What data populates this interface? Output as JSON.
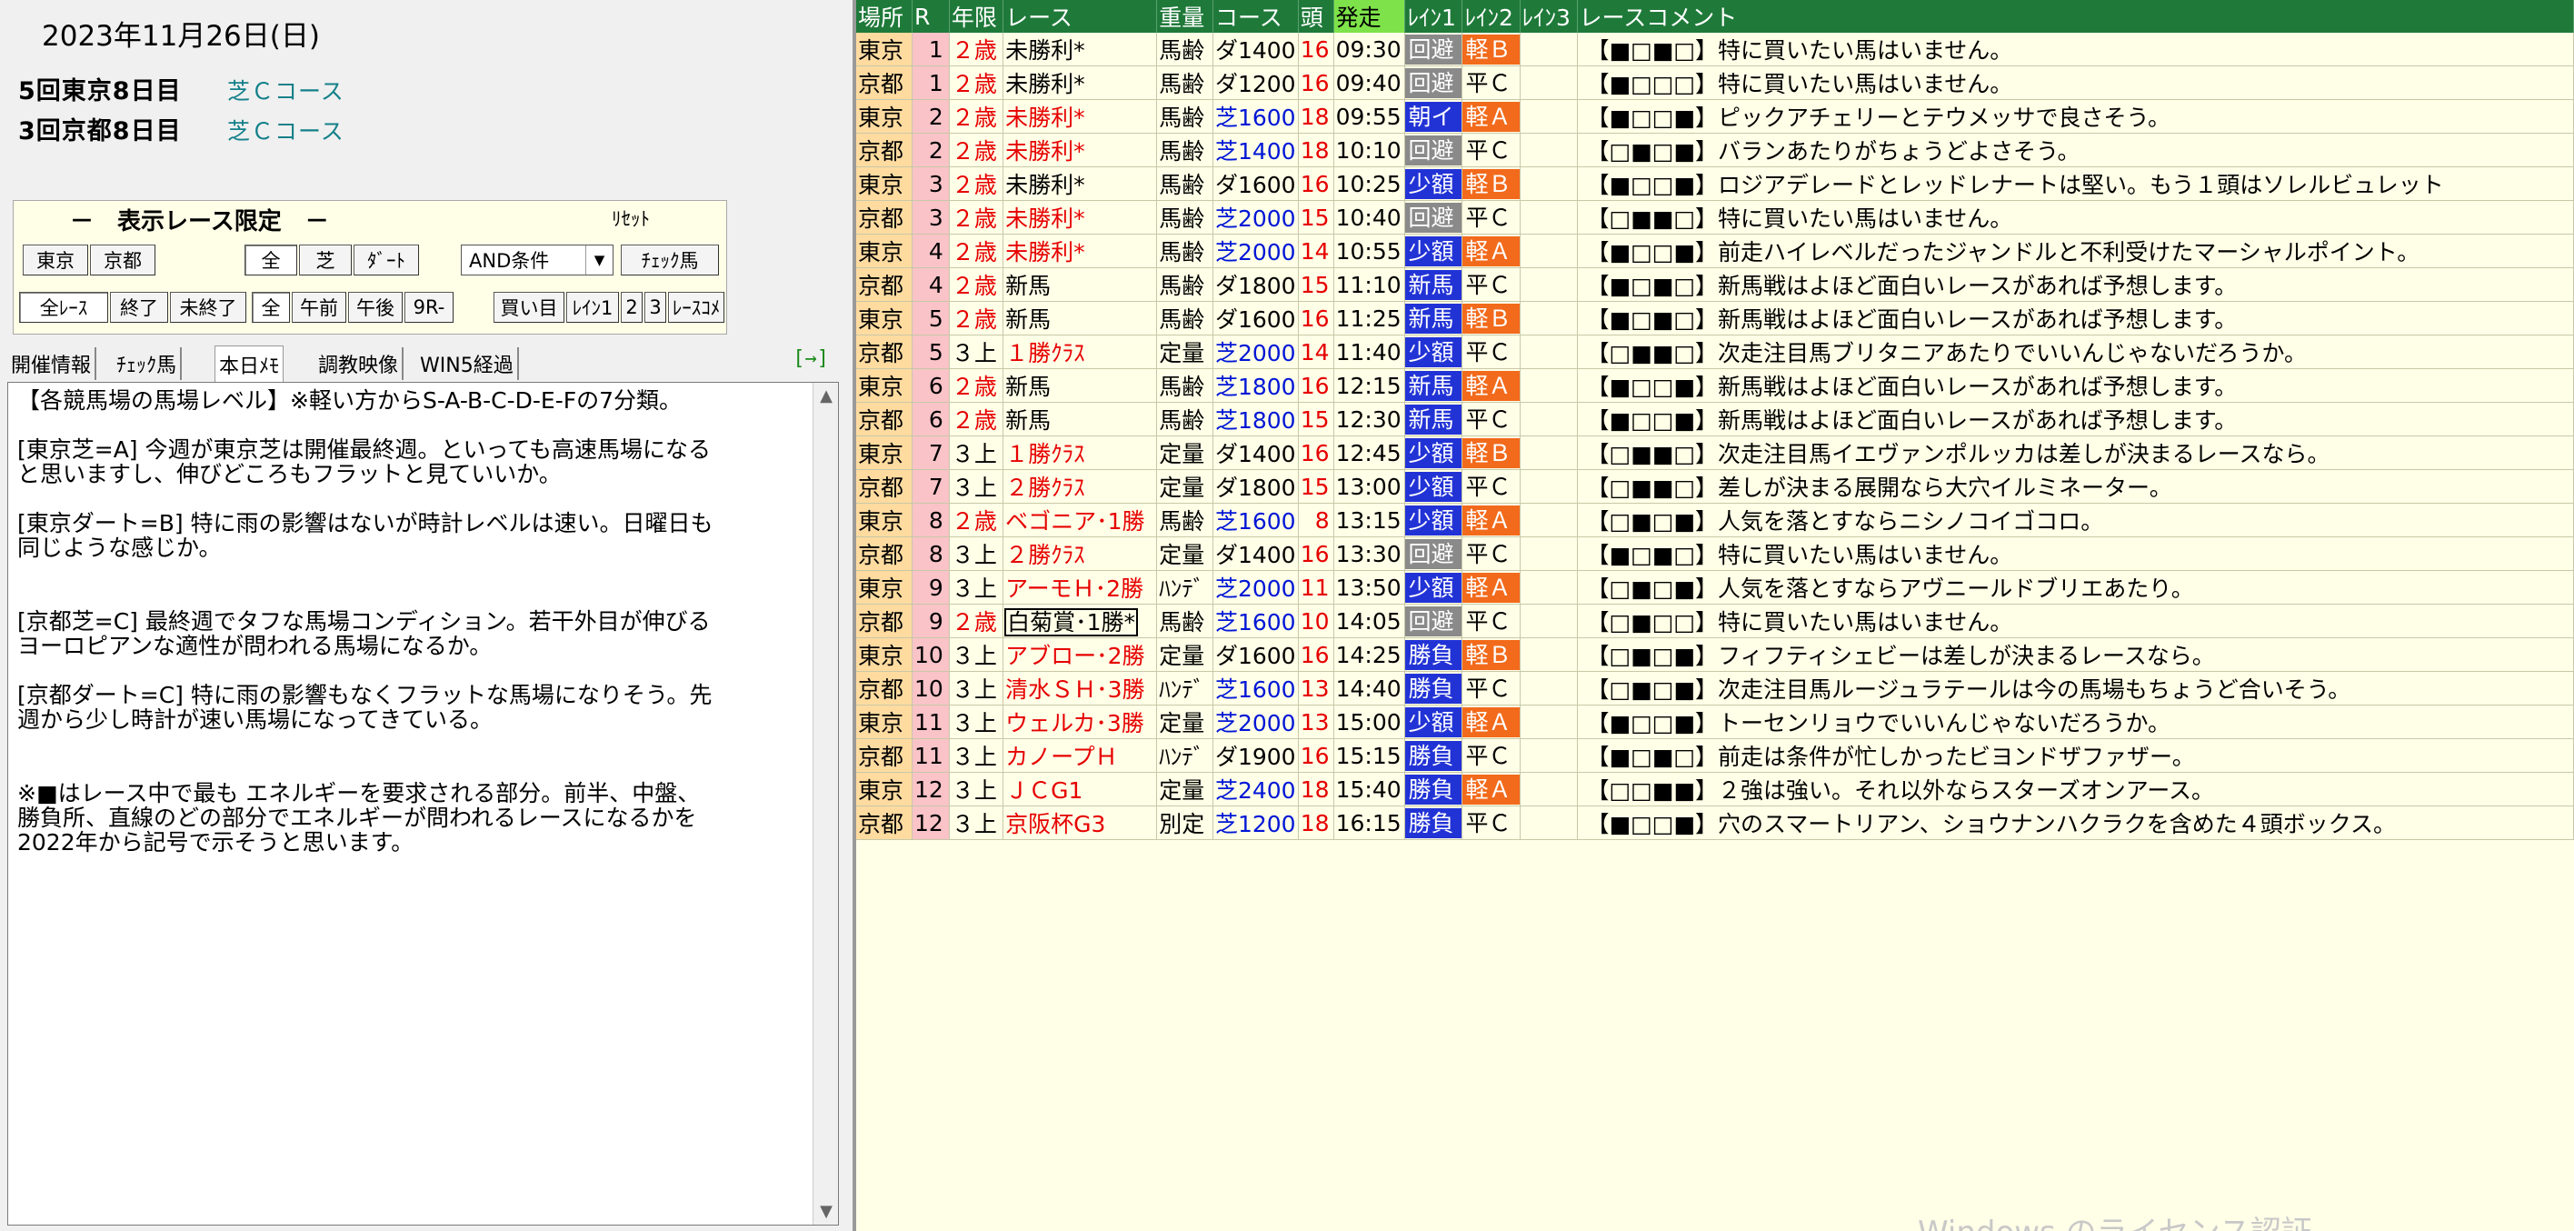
{
  "date": "2023年11月26日(日)",
  "meetings": [
    {
      "name": "5回東京8日目",
      "course": "芝Ｃコース"
    },
    {
      "name": "3回京都8日目",
      "course": "芝Ｃコース"
    }
  ],
  "filter": {
    "title": "－　表示レース限定　－",
    "reset": "ﾘｾｯﾄ",
    "venue_buttons": [
      "東京",
      "京都"
    ],
    "surface_buttons": [
      "全",
      "芝",
      "ﾀﾞｰﾄ"
    ],
    "condition_select": "AND条件",
    "check_button": "ﾁｪｯｸ馬",
    "status_buttons": [
      "全ﾚｰｽ",
      "終了",
      "未終了"
    ],
    "time_buttons": [
      "全",
      "午前",
      "午後",
      "9R-"
    ],
    "mark_buttons": [
      "買い目",
      "ﾚｲﾝ1",
      "2",
      "3",
      "ﾚｰｽｺﾒ"
    ]
  },
  "tabs": [
    "開催情報",
    "ﾁｪｯｸ馬",
    "本日ﾒﾓ",
    "調教映像",
    "WIN5経過"
  ],
  "active_tab": "本日ﾒﾓ",
  "tab_arrow": "[→]",
  "memo": "【各競馬場の馬場レベル】※軽い方からS-A-B-C-D-E-Fの7分類。\n\n[東京芝=A] 今週が東京芝は開催最終週。といっても高速馬場になる\nと思いますし、伸びどころもフラットと見ていいか。\n\n[東京ダート=B] 特に雨の影響はないが時計レベルは速い。日曜日も\n同じような感じか。\n\n\n[京都芝=C] 最終週でタフな馬場コンディション。若干外目が伸びる\nヨーロピアンな適性が問われる馬場になるか。\n\n[京都ダート=C] 特に雨の影響もなくフラットな馬場になりそう。先\n週から少し時計が速い馬場になってきている。\n\n\n※■はレース中で最も エネルギーを要求される部分。前半、中盤、\n勝負所、直線のどの部分でエネルギーが問われるレースになるかを\n2022年から記号で示そうと思います。",
  "table": {
    "headers": [
      "場所",
      "R",
      "年限",
      "レース",
      "重量",
      "コース",
      "頭",
      "発走",
      "ﾚｲﾝ1",
      "ﾚｲﾝ2",
      "ﾚｲﾝ3",
      "レースコメント"
    ],
    "rows": [
      {
        "place": "東京",
        "r": "1",
        "age": "２歳",
        "race": "未勝利*",
        "weight": "馬齢",
        "course": "ダ1400",
        "heads": "16",
        "time": "09:30",
        "l1": "回避",
        "l2": "軽Ｂ",
        "l3": "",
        "comment": "【■□■□】特に買いたい馬はいません。"
      },
      {
        "place": "京都",
        "r": "1",
        "age": "２歳",
        "race": "未勝利*",
        "weight": "馬齢",
        "course": "ダ1200",
        "heads": "16",
        "time": "09:40",
        "l1": "回避",
        "l2": "平Ｃ",
        "l3": "",
        "comment": "【■□□□】特に買いたい馬はいません。"
      },
      {
        "place": "東京",
        "r": "2",
        "age": "２歳",
        "race": "未勝利*",
        "weight": "馬齢",
        "course": "芝1600",
        "heads": "18",
        "time": "09:55",
        "l1": "朝イ",
        "l2": "軽Ａ",
        "l3": "",
        "comment": "【■□□■】ピックアチェリーとテウメッサで良さそう。"
      },
      {
        "place": "京都",
        "r": "2",
        "age": "２歳",
        "race": "未勝利*",
        "weight": "馬齢",
        "course": "芝1400",
        "heads": "18",
        "time": "10:10",
        "l1": "回避",
        "l2": "平Ｃ",
        "l3": "",
        "comment": "【□■□■】バランあたりがちょうどよさそう。"
      },
      {
        "place": "東京",
        "r": "3",
        "age": "２歳",
        "race": "未勝利*",
        "weight": "馬齢",
        "course": "ダ1600",
        "heads": "16",
        "time": "10:25",
        "l1": "少額",
        "l2": "軽Ｂ",
        "l3": "",
        "comment": "【■□□■】ロジアデレードとレッドレナートは堅い。もう１頭はソレルビュレット"
      },
      {
        "place": "京都",
        "r": "3",
        "age": "２歳",
        "race": "未勝利*",
        "weight": "馬齢",
        "course": "芝2000",
        "heads": "15",
        "time": "10:40",
        "l1": "回避",
        "l2": "平Ｃ",
        "l3": "",
        "comment": "【□■■□】特に買いたい馬はいません。"
      },
      {
        "place": "東京",
        "r": "4",
        "age": "２歳",
        "race": "未勝利*",
        "weight": "馬齢",
        "course": "芝2000",
        "heads": "14",
        "time": "10:55",
        "l1": "少額",
        "l2": "軽Ａ",
        "l3": "",
        "comment": "【■□□■】前走ハイレベルだったジャンドルと不利受けたマーシャルポイント。"
      },
      {
        "place": "京都",
        "r": "4",
        "age": "２歳",
        "race": "新馬",
        "weight": "馬齢",
        "course": "ダ1800",
        "heads": "15",
        "time": "11:10",
        "l1": "新馬",
        "l2": "平Ｃ",
        "l3": "",
        "comment": "【■□■□】新馬戦はよほど面白いレースがあれば予想します。"
      },
      {
        "place": "東京",
        "r": "5",
        "age": "２歳",
        "race": "新馬",
        "weight": "馬齢",
        "course": "ダ1600",
        "heads": "16",
        "time": "11:25",
        "l1": "新馬",
        "l2": "軽Ｂ",
        "l3": "",
        "comment": "【■□■□】新馬戦はよほど面白いレースがあれば予想します。"
      },
      {
        "place": "京都",
        "r": "5",
        "age": "３上",
        "race": "１勝ｸﾗｽ",
        "weight": "定量",
        "course": "芝2000",
        "heads": "14",
        "time": "11:40",
        "l1": "少額",
        "l2": "平Ｃ",
        "l3": "",
        "comment": "【□■■□】次走注目馬ブリタニアあたりでいいんじゃないだろうか。"
      },
      {
        "place": "東京",
        "r": "6",
        "age": "２歳",
        "race": "新馬",
        "weight": "馬齢",
        "course": "芝1800",
        "heads": "16",
        "time": "12:15",
        "l1": "新馬",
        "l2": "軽Ａ",
        "l3": "",
        "comment": "【■□□■】新馬戦はよほど面白いレースがあれば予想します。"
      },
      {
        "place": "京都",
        "r": "6",
        "age": "２歳",
        "race": "新馬",
        "weight": "馬齢",
        "course": "芝1800",
        "heads": "15",
        "time": "12:30",
        "l1": "新馬",
        "l2": "平Ｃ",
        "l3": "",
        "comment": "【■□□■】新馬戦はよほど面白いレースがあれば予想します。"
      },
      {
        "place": "東京",
        "r": "7",
        "age": "３上",
        "race": "１勝ｸﾗｽ",
        "weight": "定量",
        "course": "ダ1400",
        "heads": "16",
        "time": "12:45",
        "l1": "少額",
        "l2": "軽Ｂ",
        "l3": "",
        "comment": "【□■■□】次走注目馬イエヴァンポルッカは差しが決まるレースなら。"
      },
      {
        "place": "京都",
        "r": "7",
        "age": "３上",
        "race": "２勝ｸﾗｽ",
        "weight": "定量",
        "course": "ダ1800",
        "heads": "15",
        "time": "13:00",
        "l1": "少額",
        "l2": "平Ｃ",
        "l3": "",
        "comment": "【□■■□】差しが決まる展開なら大穴イルミネーター。"
      },
      {
        "place": "東京",
        "r": "8",
        "age": "２歳",
        "race": "ベゴニア･1勝",
        "weight": "馬齢",
        "course": "芝1600",
        "heads": "8",
        "time": "13:15",
        "l1": "少額",
        "l2": "軽Ａ",
        "l3": "",
        "comment": "【□■□■】人気を落とすならニシノコイゴコロ。"
      },
      {
        "place": "京都",
        "r": "8",
        "age": "３上",
        "race": "２勝ｸﾗｽ",
        "weight": "定量",
        "course": "ダ1400",
        "heads": "16",
        "time": "13:30",
        "l1": "回避",
        "l2": "平Ｃ",
        "l3": "",
        "comment": "【■□■□】特に買いたい馬はいません。"
      },
      {
        "place": "東京",
        "r": "9",
        "age": "３上",
        "race": "アーモＨ･2勝",
        "weight": "ﾊﾝﾃﾞ",
        "course": "芝2000",
        "heads": "11",
        "time": "13:50",
        "l1": "少額",
        "l2": "軽Ａ",
        "l3": "",
        "comment": "【□■□■】人気を落とすならアヴニールドブリエあたり。"
      },
      {
        "place": "京都",
        "r": "9",
        "age": "２歳",
        "race": "白菊賞･1勝*",
        "weight": "馬齢",
        "course": "芝1600",
        "heads": "10",
        "time": "14:05",
        "l1": "回避",
        "l2": "平Ｃ",
        "l3": "",
        "comment": "【□■□□】特に買いたい馬はいません。"
      },
      {
        "place": "東京",
        "r": "10",
        "age": "３上",
        "race": "アブロー･2勝",
        "weight": "定量",
        "course": "ダ1600",
        "heads": "16",
        "time": "14:25",
        "l1": "勝負",
        "l2": "軽Ｂ",
        "l3": "",
        "comment": "【□■□■】フィフティシェビーは差しが決まるレースなら。"
      },
      {
        "place": "京都",
        "r": "10",
        "age": "３上",
        "race": "清水ＳＨ･3勝",
        "weight": "ﾊﾝﾃﾞ",
        "course": "芝1600",
        "heads": "13",
        "time": "14:40",
        "l1": "勝負",
        "l2": "平Ｃ",
        "l3": "",
        "comment": "【□■□■】次走注目馬ルージュラテールは今の馬場もちょうど合いそう。"
      },
      {
        "place": "東京",
        "r": "11",
        "age": "３上",
        "race": "ウェルカ･3勝",
        "weight": "定量",
        "course": "芝2000",
        "heads": "13",
        "time": "15:00",
        "l1": "少額",
        "l2": "軽Ａ",
        "l3": "",
        "comment": "【■□□■】トーセンリョウでいいんじゃないだろうか。"
      },
      {
        "place": "京都",
        "r": "11",
        "age": "３上",
        "race": "カノープＨ",
        "weight": "ﾊﾝﾃﾞ",
        "course": "ダ1900",
        "heads": "16",
        "time": "15:15",
        "l1": "勝負",
        "l2": "平Ｃ",
        "l3": "",
        "comment": "【■□■□】前走は条件が忙しかったビヨンドザファザー。"
      },
      {
        "place": "東京",
        "r": "12",
        "age": "３上",
        "race": "ＪＣG1",
        "weight": "定量",
        "course": "芝2400",
        "heads": "18",
        "time": "15:40",
        "l1": "勝負",
        "l2": "軽Ａ",
        "l3": "",
        "comment": "【□□■■】２強は強い。それ以外ならスターズオンアース。"
      },
      {
        "place": "京都",
        "r": "12",
        "age": "３上",
        "race": "京阪杯G3",
        "weight": "別定",
        "course": "芝1200",
        "heads": "18",
        "time": "16:15",
        "l1": "勝負",
        "l2": "平Ｃ",
        "l3": "",
        "comment": "【■□□■】穴のスマートリアン、ショウナンハクラクを含めた４頭ボックス。"
      }
    ]
  },
  "colors": {
    "header_bg": "#1f7a3a",
    "header_highlight": "#7ee34a",
    "grid_bg": "#ffffe8",
    "kaihi": "#8a8a8a",
    "shougaku": "#2233d6",
    "shinba": "#2233d6",
    "shoubu": "#2233d6",
    "asai": "#2233d6",
    "kei": "#f26a1b",
    "hei_text": "#000000"
  },
  "watermark": "Windows のライセンス認証"
}
